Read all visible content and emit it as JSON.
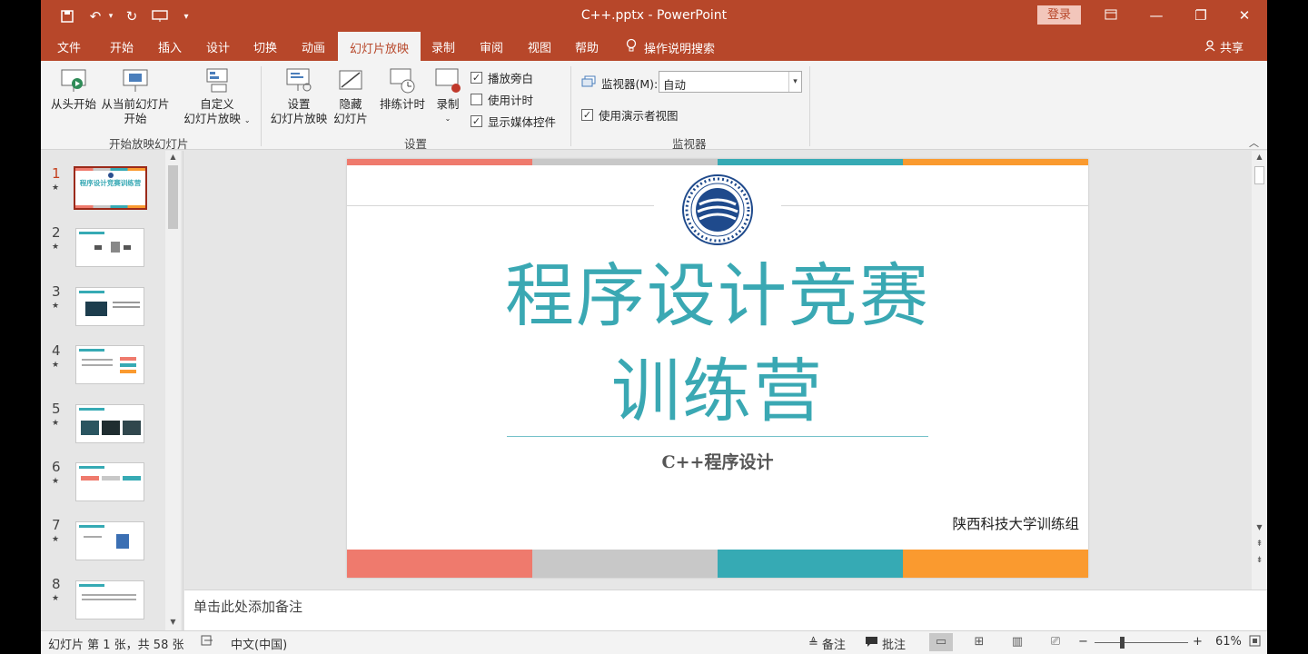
{
  "app": {
    "title": "C++.pptx  -  PowerPoint",
    "login": "登录",
    "qa_icons": [
      "save-icon",
      "undo-icon",
      "redo-icon",
      "present-from-start-icon",
      "customize-icon"
    ]
  },
  "tabs": {
    "items": [
      "文件",
      "开始",
      "插入",
      "设计",
      "切换",
      "动画",
      "幻灯片放映",
      "录制",
      "审阅",
      "视图",
      "帮助"
    ],
    "active": "幻灯片放映",
    "tell_me": "操作说明搜索",
    "share": "共享"
  },
  "ribbon": {
    "start_group": {
      "from_beginning": "从头开始",
      "from_current_l1": "从当前幻灯片",
      "from_current_l2": "开始",
      "custom_l1": "自定义",
      "custom_l2": "幻灯片放映",
      "label": "开始放映幻灯片"
    },
    "setup_group": {
      "setup_l1": "设置",
      "setup_l2": "幻灯片放映",
      "hide_l1": "隐藏",
      "hide_l2": "幻灯片",
      "rehearse": "排练计时",
      "record": "录制",
      "play_narrations": "播放旁白",
      "use_timings": "使用计时",
      "show_media": "显示媒体控件",
      "label": "设置"
    },
    "monitor_group": {
      "monitor_label": "监视器(M):",
      "monitor_value": "自动",
      "presenter_view": "使用演示者视图",
      "label": "监视器"
    },
    "checks": {
      "play_narrations": true,
      "use_timings": false,
      "show_media": true,
      "presenter_view": true
    }
  },
  "thumbnails": [
    {
      "num": "1",
      "title": "程序设计竞赛训练营"
    },
    {
      "num": "2"
    },
    {
      "num": "3"
    },
    {
      "num": "4"
    },
    {
      "num": "5"
    },
    {
      "num": "6"
    },
    {
      "num": "7"
    },
    {
      "num": "8"
    }
  ],
  "slide": {
    "title_line1": "程序设计竞赛",
    "title_line2": "训练营",
    "subtitle": "C++程序设计",
    "org": "陕西科技大学训练组",
    "colors": {
      "red": "#ef7a6d",
      "gray": "#c8c8c8",
      "teal": "#36aab4",
      "orange": "#fa9a2f"
    }
  },
  "notes": {
    "placeholder": "单击此处添加备注"
  },
  "status": {
    "slide_info": "幻灯片 第 1 张，共 58 张",
    "language": "中文(中国)",
    "notes": "备注",
    "comments": "批注",
    "zoom": "61%"
  }
}
